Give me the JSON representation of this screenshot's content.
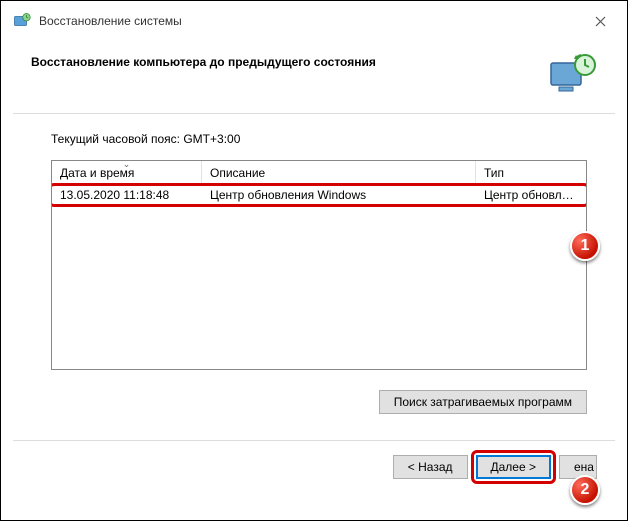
{
  "window": {
    "title": "Восстановление системы"
  },
  "header": {
    "heading": "Восстановление компьютера до предыдущего состояния"
  },
  "content": {
    "timezone_label": "Текущий часовой пояс: GMT+3:00",
    "columns": {
      "date": "Дата и время",
      "desc": "Описание",
      "type": "Тип"
    },
    "rows": [
      {
        "date": "13.05.2020 11:18:48",
        "desc": "Центр обновления Windows",
        "type": "Центр обновле..."
      }
    ],
    "affected_btn": "Поиск затрагиваемых программ"
  },
  "footer": {
    "back": "< Назад",
    "next": "Далее >",
    "cancel": "ена"
  },
  "markers": {
    "one": "1",
    "two": "2"
  }
}
